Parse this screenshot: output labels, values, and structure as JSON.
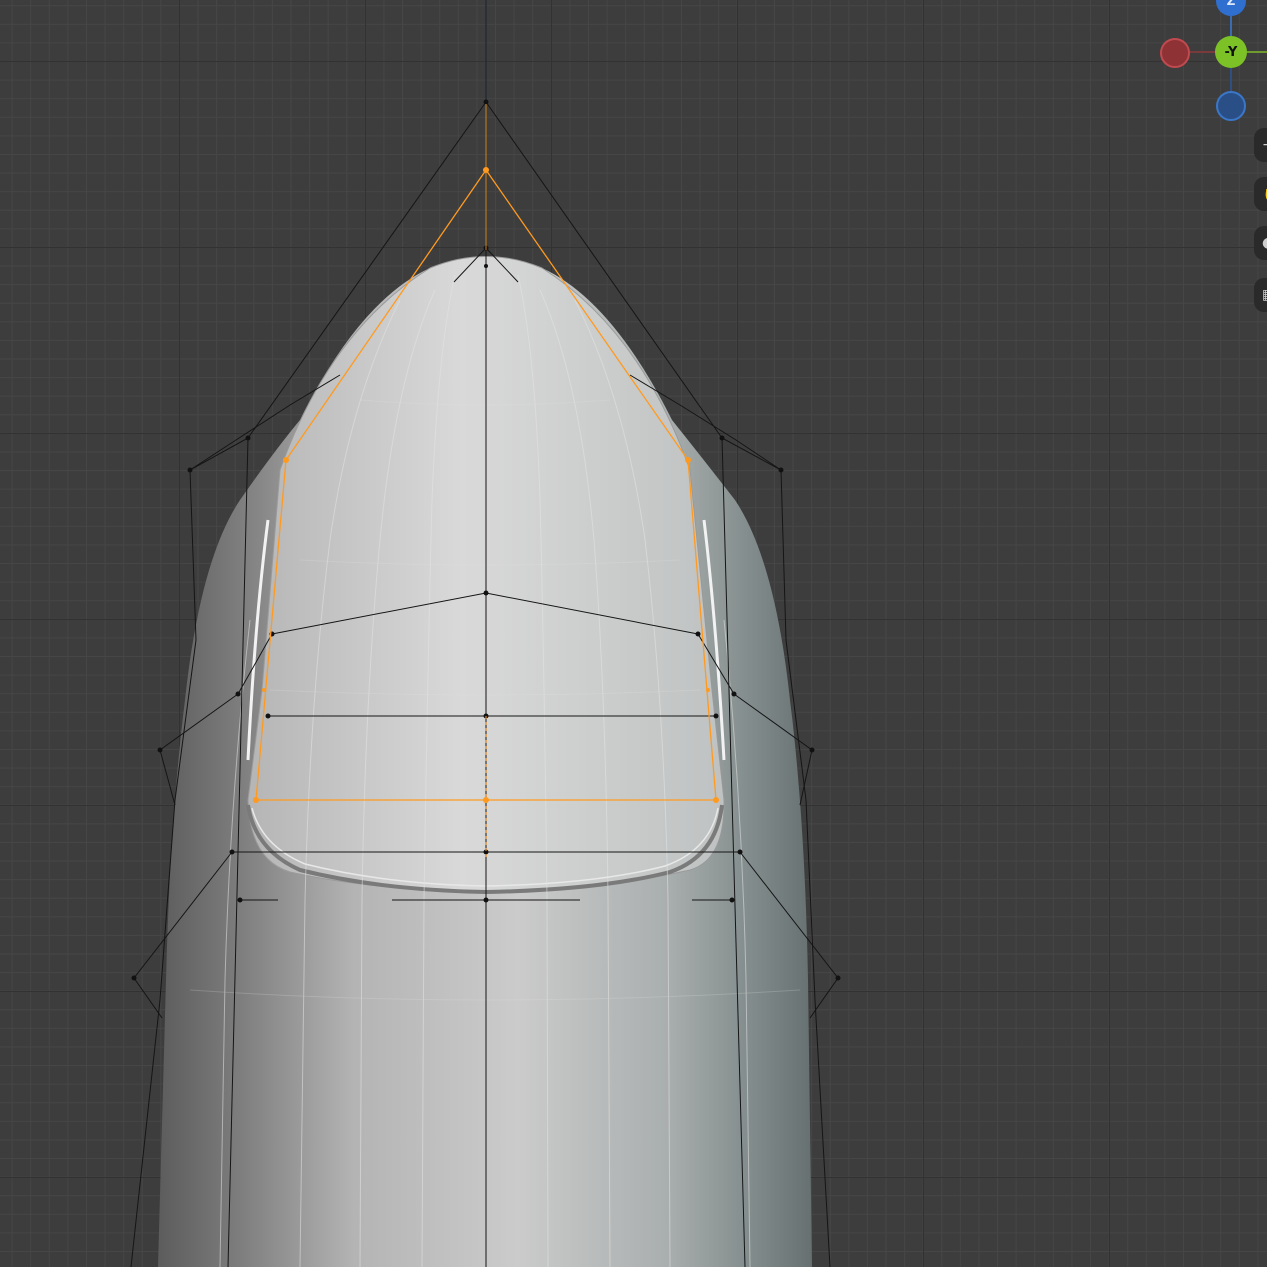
{
  "viewport": {
    "background_color": "#3d3d3d",
    "grid_minor_color": "#464646",
    "grid_major_color": "#323232"
  },
  "navigation_gizmo": {
    "top_axis_label": "Z",
    "center_axis_label": "-Y",
    "colors": {
      "x": "#c04a4f",
      "y": "#7cc226",
      "z": "#3b77c9"
    }
  },
  "side_toolbar": {
    "items": [
      {
        "icon": "zoom-icon"
      },
      {
        "icon": "pan-hand-icon"
      },
      {
        "icon": "camera-icon"
      },
      {
        "icon": "perspective-grid-icon"
      }
    ]
  },
  "mesh": {
    "surface_color": "#c8c8c8",
    "cage_color": "#111111",
    "selection_color": "#ff9a1f"
  }
}
